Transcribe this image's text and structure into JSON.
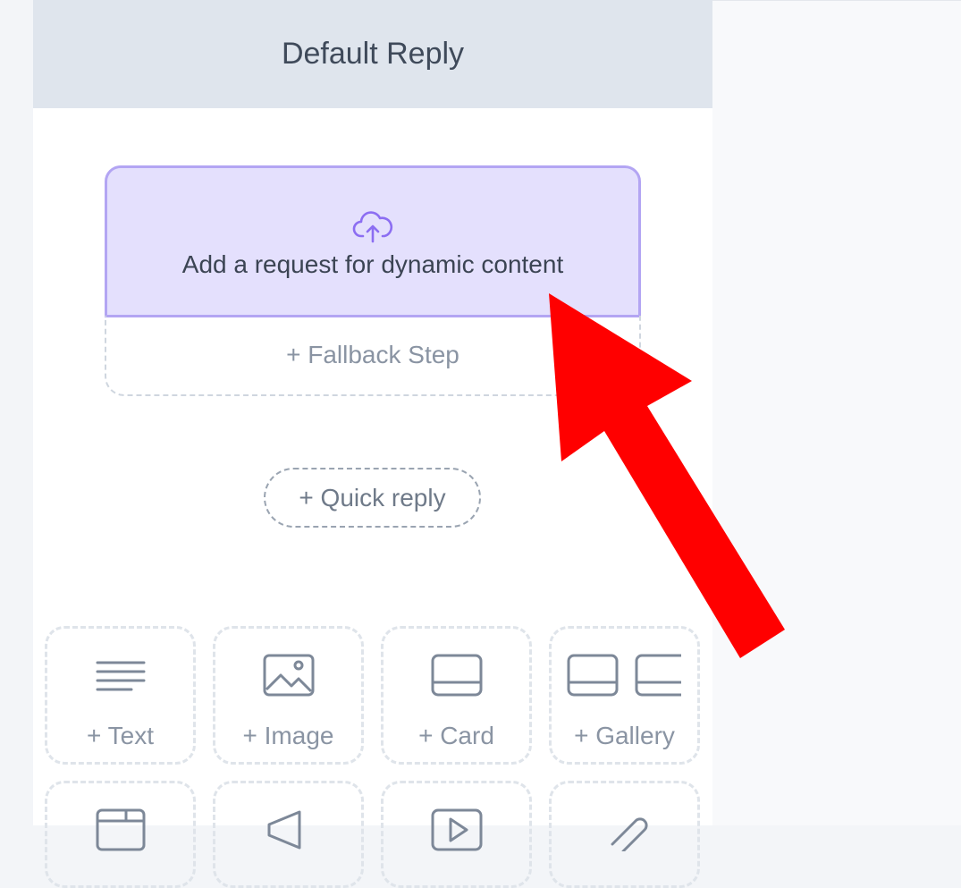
{
  "panel": {
    "title": "Default Reply"
  },
  "dynamic_content": {
    "label": "Add a request for dynamic content",
    "icon": "cloud-upload-icon"
  },
  "fallback": {
    "label": "+ Fallback Step"
  },
  "quick_reply": {
    "label": "+ Quick reply"
  },
  "content_tiles": [
    {
      "label": "+ Text",
      "icon": "text-lines-icon"
    },
    {
      "label": "+ Image",
      "icon": "image-icon"
    },
    {
      "label": "+ Card",
      "icon": "card-icon"
    },
    {
      "label": "+ Gallery",
      "icon": "gallery-icon"
    }
  ],
  "colors": {
    "accent_bg": "#e4e0fd",
    "accent_border": "#b3a5f3",
    "icon_purple": "#8c6ef2",
    "annotation_arrow": "#ff0000"
  }
}
